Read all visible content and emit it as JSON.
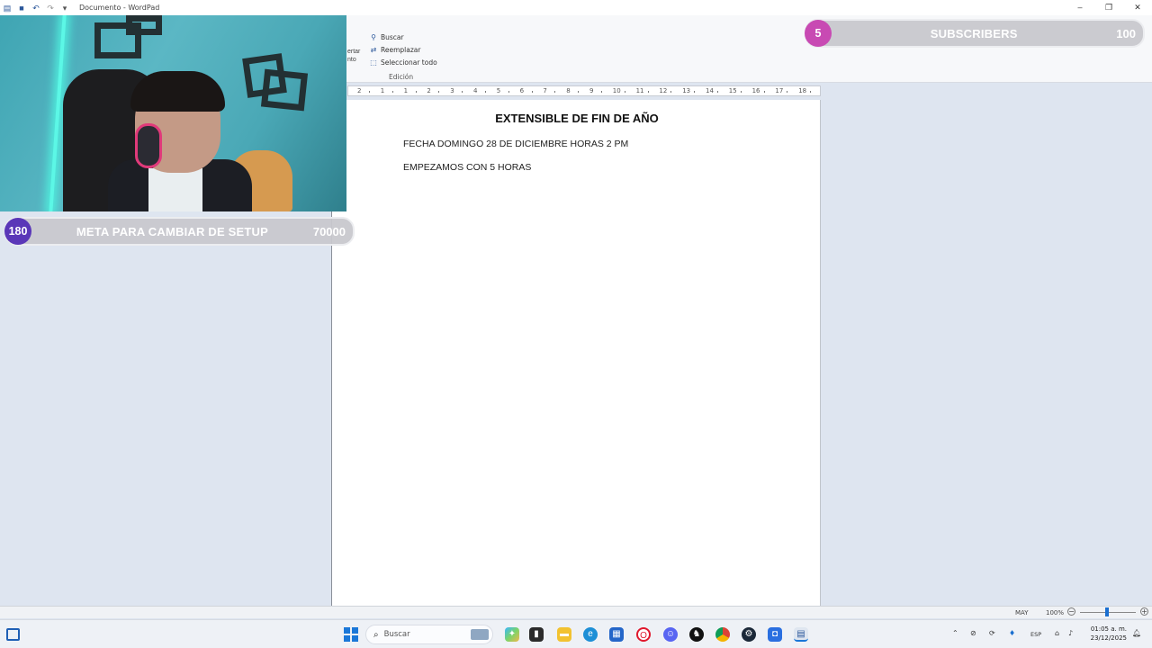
{
  "window": {
    "title": "Documento - WordPad",
    "controls": {
      "minimize": "–",
      "maximize": "❐",
      "close": "✕"
    }
  },
  "ribbon": {
    "paste_fragment": [
      "ertar",
      "nto"
    ],
    "edit_group": {
      "find": "Buscar",
      "replace": "Reemplazar",
      "select_all": "Seleccionar todo",
      "label": "Edición"
    }
  },
  "ruler": {
    "labels": [
      "2",
      "1",
      "1",
      "2",
      "3",
      "4",
      "5",
      "6",
      "7",
      "8",
      "9",
      "10",
      "11",
      "12",
      "13",
      "14",
      "15",
      "16",
      "17",
      "18"
    ]
  },
  "document": {
    "heading": "EXTENSIBLE DE FIN DE AÑO",
    "lines": [
      "FECHA DOMINGO 28 DE DICIEMBRE HORAS 2 PM",
      "EMPEZAMOS CON 5 HORAS"
    ]
  },
  "overlays": {
    "goal_setup": {
      "current": "180",
      "label": "META PARA CAMBIAR DE SETUP",
      "target": "70000"
    },
    "goal_subs": {
      "current": "5",
      "label": "SUBSCRIBERS",
      "target": "100"
    }
  },
  "statusbar": {
    "caps": "MAY",
    "zoom": "100%",
    "zoom_level": 0.48
  },
  "taskbar": {
    "search_placeholder": "Buscar",
    "tray": {
      "language": "ESP"
    },
    "clock": {
      "time": "01:05 a. m.",
      "date": "23/12/2025"
    }
  },
  "colors": {
    "accent": "#1a77d8",
    "goal_setup_badge": "#5a37b8",
    "goal_subs_badge": "#c84ab3",
    "webcam_led": "#5cf7e6"
  }
}
